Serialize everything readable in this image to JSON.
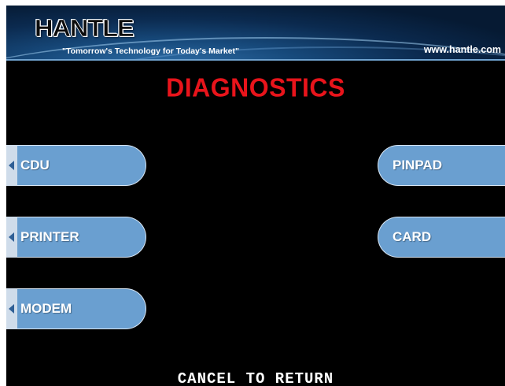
{
  "header": {
    "logo_text": "HANTLE",
    "tagline": "\"Tomorrow's Technology for Today's Market\"",
    "website": "www.hantle.com"
  },
  "title": "DIAGNOSTICS",
  "buttons": {
    "left": [
      {
        "label": "CDU"
      },
      {
        "label": "PRINTER"
      },
      {
        "label": "MODEM"
      }
    ],
    "right": [
      {
        "label": "PINPAD"
      },
      {
        "label": "CARD"
      }
    ]
  },
  "footer": "CANCEL TO RETURN",
  "colors": {
    "screen_bg": "#000000",
    "title": "#e8141b",
    "button": "#6a9fd0",
    "header_bg": "#0b2a4f"
  }
}
